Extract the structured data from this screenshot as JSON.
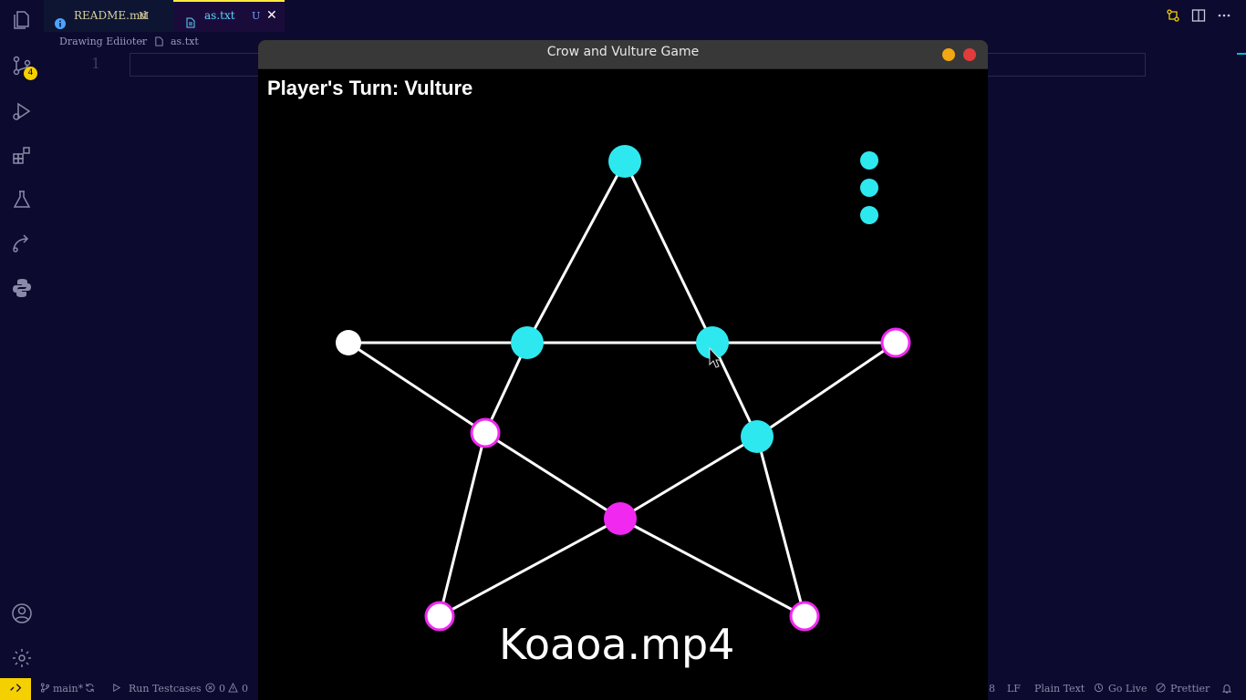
{
  "activity_bar": {
    "icons": [
      "explorer-icon",
      "source-control-icon",
      "run-debug-icon",
      "extensions-icon",
      "testing-icon",
      "remote-explorer-icon",
      "python-icon",
      "accounts-icon",
      "settings-gear-icon"
    ],
    "source_control_badge": "4"
  },
  "tabs": [
    {
      "label": "README.md",
      "mark": "M",
      "active": false
    },
    {
      "label": "as.txt",
      "mark": "U",
      "active": true
    }
  ],
  "breadcrumb": {
    "folder": "Drawing Ediioter",
    "file": "as.txt"
  },
  "editor": {
    "line_number": "1"
  },
  "status_bar": {
    "branch": "main*",
    "run_testcases": "Run Testcases",
    "errors": "0",
    "warnings": "0",
    "line_ending": "LF",
    "language": "Plain Text",
    "go_live": "Go Live",
    "prettier": "Prettier",
    "partial_left": "8"
  },
  "game": {
    "window_title": "Crow and Vulture Game",
    "turn_text": "Player's Turn: Vulture",
    "watermark": "Koaoa.mp4",
    "colors": {
      "crow": "#2ee8f0",
      "vulture": "#f028f0",
      "empty": "#ffffff",
      "line": "#ffffff"
    },
    "nodes": [
      {
        "id": "top",
        "state": "crow"
      },
      {
        "id": "left",
        "state": "empty"
      },
      {
        "id": "inner-top-left",
        "state": "crow"
      },
      {
        "id": "inner-top-right",
        "state": "crow"
      },
      {
        "id": "right",
        "state": "empty-highlight"
      },
      {
        "id": "inner-left",
        "state": "empty-highlight"
      },
      {
        "id": "inner-right",
        "state": "crow"
      },
      {
        "id": "inner-bottom",
        "state": "vulture"
      },
      {
        "id": "bottom-left",
        "state": "empty-highlight"
      },
      {
        "id": "bottom-right",
        "state": "empty-highlight"
      }
    ],
    "edges": [
      [
        "left",
        "inner-top-left"
      ],
      [
        "inner-top-left",
        "inner-top-right"
      ],
      [
        "inner-top-right",
        "right"
      ],
      [
        "top",
        "inner-top-left"
      ],
      [
        "inner-top-left",
        "inner-left"
      ],
      [
        "inner-left",
        "bottom-left"
      ],
      [
        "top",
        "inner-top-right"
      ],
      [
        "inner-top-right",
        "inner-right"
      ],
      [
        "inner-right",
        "bottom-right"
      ],
      [
        "left",
        "inner-left"
      ],
      [
        "inner-left",
        "inner-bottom"
      ],
      [
        "inner-bottom",
        "bottom-right"
      ],
      [
        "right",
        "inner-right"
      ],
      [
        "inner-right",
        "inner-bottom"
      ],
      [
        "inner-bottom",
        "bottom-left"
      ]
    ],
    "crows_remaining": 3
  }
}
